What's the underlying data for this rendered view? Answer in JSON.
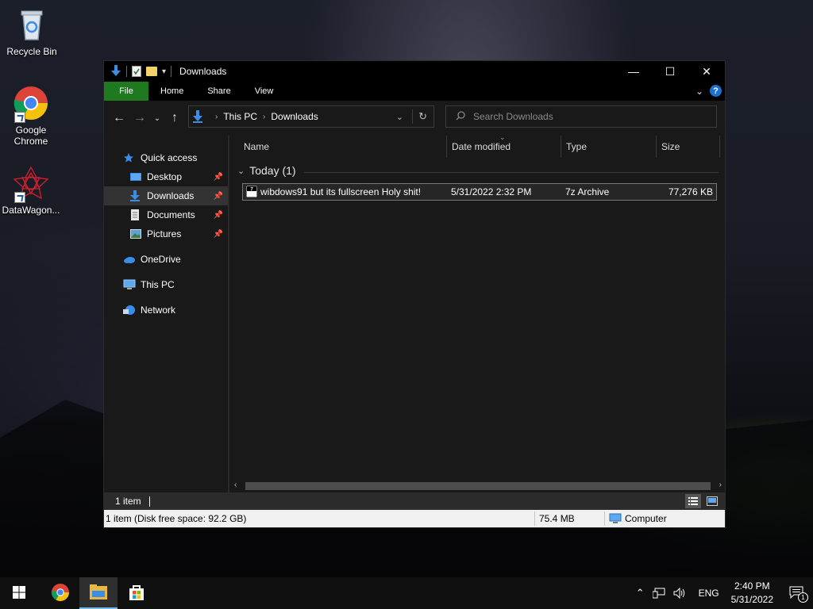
{
  "desktop": {
    "icons": [
      {
        "label": "Recycle Bin"
      },
      {
        "label": "Google\nChrome"
      },
      {
        "label": "DataWagon..."
      }
    ]
  },
  "window": {
    "title": "Downloads",
    "controls": {
      "minimize": "—",
      "maximize": "☐",
      "close": "✕"
    },
    "ribbon": {
      "tabs": [
        "File",
        "Home",
        "Share",
        "View"
      ],
      "help": "?"
    },
    "address": {
      "crumbs": [
        "This PC",
        "Downloads"
      ]
    },
    "search": {
      "placeholder": "Search Downloads"
    },
    "sidebar": {
      "items": [
        {
          "label": "Quick access",
          "icon": "star-icon"
        },
        {
          "label": "Desktop",
          "icon": "desktop-icon",
          "pinned": true
        },
        {
          "label": "Downloads",
          "icon": "download-icon",
          "pinned": true,
          "selected": true
        },
        {
          "label": "Documents",
          "icon": "document-icon",
          "pinned": true
        },
        {
          "label": "Pictures",
          "icon": "pictures-icon",
          "pinned": true
        },
        {
          "label": "OneDrive",
          "icon": "cloud-icon"
        },
        {
          "label": "This PC",
          "icon": "computer-icon"
        },
        {
          "label": "Network",
          "icon": "network-icon"
        }
      ]
    },
    "columns": [
      "Name",
      "Date modified",
      "Type",
      "Size"
    ],
    "group": {
      "label": "Today (1)"
    },
    "files": [
      {
        "name": "wibdows91 but its fullscreen Holy shit!",
        "date": "5/31/2022 2:32 PM",
        "type": "7z Archive",
        "size": "77,276 KB"
      }
    ],
    "status": {
      "item_count": "1 item",
      "detail": "1 item (Disk free space: 92.2 GB)",
      "size": "75.4 MB",
      "location": "Computer"
    }
  },
  "taskbar": {
    "language": "ENG",
    "time": "2:40 PM",
    "date": "5/31/2022",
    "notification_count": "1"
  },
  "colors": {
    "file_tab": "#1f7a1f",
    "accent": "#3b8ee8",
    "selection": "#333333"
  }
}
